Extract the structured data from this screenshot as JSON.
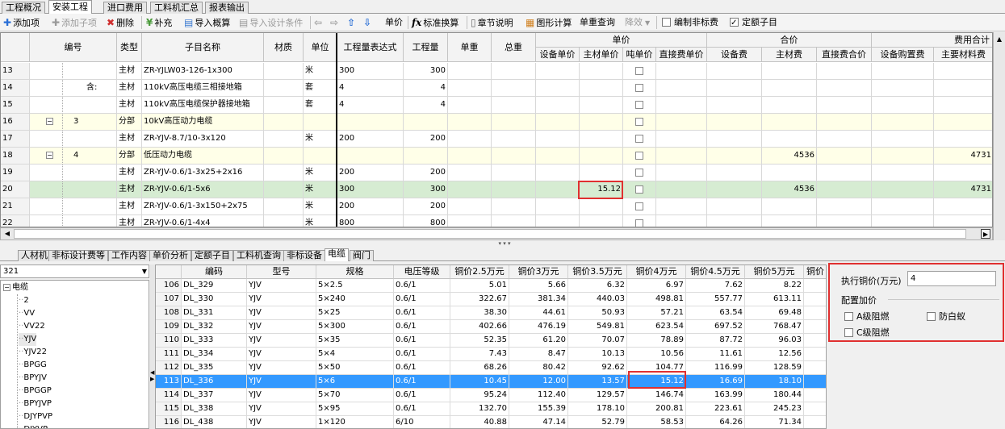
{
  "top_tabs": [
    "工程概况",
    "安装工程",
    "进口费用",
    "工料机汇总",
    "报表输出"
  ],
  "toolbar": {
    "add_item": "添加项",
    "add_subitem": "添加子项",
    "delete": "删除",
    "supplement": "补充",
    "import_estimate": "导入概算",
    "import_design": "导入设计条件",
    "unit_price": "单价",
    "standard_convert": "标准换算",
    "chapter_note": "章节说明",
    "graphic_calc": "图形计算",
    "unit_weight_query": "单重查询",
    "coefficient": "降效",
    "edit_nonstandard": "编制非标费",
    "quota_subitem": "定额子目"
  },
  "grid": {
    "headers": {
      "code": "编号",
      "type": "类型",
      "name": "子目名称",
      "material": "材质",
      "unit": "单位",
      "expr": "工程量表达式",
      "qty": "工程量",
      "unit_weight": "单重",
      "total_weight": "总重",
      "unit_price_group": "单价",
      "total_price_group": "合价",
      "fee_total_group": "费用合计",
      "equip_unit": "设备单价",
      "main_mat_unit": "主材单价",
      "ton_unit": "吨单价",
      "direct_fee_unit": "直接费单价",
      "equip_fee": "设备费",
      "main_mat_fee": "主材费",
      "direct_fee_total": "直接费合价",
      "equip_purchase": "设备购置费",
      "main_mat_cost": "主要材料费"
    },
    "rows": [
      {
        "num": "13",
        "code": "",
        "type": "主材",
        "name": "ZR-YJLW03-126-1x300",
        "unit": "米",
        "expr": "300",
        "qty": "300",
        "mat_unit": "",
        "main_mat_fee": "",
        "fee_total": ""
      },
      {
        "num": "14",
        "code": "含:",
        "type": "主材",
        "name": "110kV高压电缆三相接地箱",
        "unit": "套",
        "expr": "4",
        "qty": "4",
        "mat_unit": "",
        "main_mat_fee": "",
        "fee_total": ""
      },
      {
        "num": "15",
        "code": "",
        "type": "主材",
        "name": "110kV高压电缆保护器接地箱",
        "unit": "套",
        "expr": "4",
        "qty": "4",
        "mat_unit": "",
        "main_mat_fee": "",
        "fee_total": ""
      },
      {
        "num": "16",
        "code": "3",
        "type": "分部",
        "name": "10kV高压动力电缆",
        "unit": "",
        "expr": "",
        "qty": "",
        "mat_unit": "",
        "main_mat_fee": "",
        "fee_total": ""
      },
      {
        "num": "17",
        "code": "",
        "type": "主材",
        "name": "ZR-YJV-8.7/10-3x120",
        "unit": "米",
        "expr": "200",
        "qty": "200",
        "mat_unit": "",
        "main_mat_fee": "",
        "fee_total": ""
      },
      {
        "num": "18",
        "code": "4",
        "type": "分部",
        "name": "低压动力电缆",
        "unit": "",
        "expr": "",
        "qty": "",
        "mat_unit": "",
        "main_mat_fee": "4536",
        "fee_total": "4731"
      },
      {
        "num": "19",
        "code": "",
        "type": "主材",
        "name": "ZR-YJV-0.6/1-3x25+2x16",
        "unit": "米",
        "expr": "200",
        "qty": "200",
        "mat_unit": "",
        "main_mat_fee": "",
        "fee_total": ""
      },
      {
        "num": "20",
        "code": "",
        "type": "主材",
        "name": "ZR-YJV-0.6/1-5x6",
        "unit": "米",
        "expr": "300",
        "qty": "300",
        "mat_unit": "15.12",
        "main_mat_fee": "4536",
        "fee_total": "4731"
      },
      {
        "num": "21",
        "code": "",
        "type": "主材",
        "name": "ZR-YJV-0.6/1-3x150+2x75",
        "unit": "米",
        "expr": "200",
        "qty": "200",
        "mat_unit": "",
        "main_mat_fee": "",
        "fee_total": ""
      },
      {
        "num": "22",
        "code": "",
        "type": "主材",
        "name": "ZR-YJV-0.6/1-4x4",
        "unit": "米",
        "expr": "800",
        "qty": "800",
        "mat_unit": "",
        "main_mat_fee": "",
        "fee_total": ""
      }
    ]
  },
  "bottom_tabs": [
    "人材机",
    "非标设计费等",
    "工作内容",
    "单价分析",
    "定额子目",
    "工料机查询",
    "非标设备",
    "电缆",
    "阀门"
  ],
  "combo_value": "321",
  "tree": {
    "root": "电缆",
    "items": [
      "2",
      "VV",
      "VV22",
      "YJV",
      "YJV22",
      "BPGG",
      "BPYJV",
      "BPGGP",
      "BPYJVP",
      "DJYPVP",
      "DJYVP"
    ]
  },
  "price_grid": {
    "headers": [
      "编码",
      "型号",
      "规格",
      "电压等级",
      "铜价2.5万元",
      "铜价3万元",
      "铜价3.5万元",
      "铜价4万元",
      "铜价4.5万元",
      "铜价5万元",
      "铜价"
    ],
    "rows": [
      {
        "n": "106",
        "code": "DL_329",
        "model": "YJV",
        "spec": "5×2.5",
        "volt": "0.6/1",
        "p25": "5.01",
        "p30": "5.66",
        "p35": "6.32",
        "p40": "6.97",
        "p45": "7.62",
        "p50": "8.22"
      },
      {
        "n": "107",
        "code": "DL_330",
        "model": "YJV",
        "spec": "5×240",
        "volt": "0.6/1",
        "p25": "322.67",
        "p30": "381.34",
        "p35": "440.03",
        "p40": "498.81",
        "p45": "557.77",
        "p50": "613.11"
      },
      {
        "n": "108",
        "code": "DL_331",
        "model": "YJV",
        "spec": "5×25",
        "volt": "0.6/1",
        "p25": "38.30",
        "p30": "44.61",
        "p35": "50.93",
        "p40": "57.21",
        "p45": "63.54",
        "p50": "69.48"
      },
      {
        "n": "109",
        "code": "DL_332",
        "model": "YJV",
        "spec": "5×300",
        "volt": "0.6/1",
        "p25": "402.66",
        "p30": "476.19",
        "p35": "549.81",
        "p40": "623.54",
        "p45": "697.52",
        "p50": "768.47"
      },
      {
        "n": "110",
        "code": "DL_333",
        "model": "YJV",
        "spec": "5×35",
        "volt": "0.6/1",
        "p25": "52.35",
        "p30": "61.20",
        "p35": "70.07",
        "p40": "78.89",
        "p45": "87.72",
        "p50": "96.03"
      },
      {
        "n": "111",
        "code": "DL_334",
        "model": "YJV",
        "spec": "5×4",
        "volt": "0.6/1",
        "p25": "7.43",
        "p30": "8.47",
        "p35": "10.13",
        "p40": "10.56",
        "p45": "11.61",
        "p50": "12.56"
      },
      {
        "n": "112",
        "code": "DL_335",
        "model": "YJV",
        "spec": "5×50",
        "volt": "0.6/1",
        "p25": "68.26",
        "p30": "80.42",
        "p35": "92.62",
        "p40": "104.77",
        "p45": "116.99",
        "p50": "128.59"
      },
      {
        "n": "113",
        "code": "DL_336",
        "model": "YJV",
        "spec": "5×6",
        "volt": "0.6/1",
        "p25": "10.45",
        "p30": "12.00",
        "p35": "13.57",
        "p40": "15.12",
        "p45": "16.69",
        "p50": "18.10"
      },
      {
        "n": "114",
        "code": "DL_337",
        "model": "YJV",
        "spec": "5×70",
        "volt": "0.6/1",
        "p25": "95.24",
        "p30": "112.40",
        "p35": "129.57",
        "p40": "146.74",
        "p45": "163.99",
        "p50": "180.44"
      },
      {
        "n": "115",
        "code": "DL_338",
        "model": "YJV",
        "spec": "5×95",
        "volt": "0.6/1",
        "p25": "132.70",
        "p30": "155.39",
        "p35": "178.10",
        "p40": "200.81",
        "p45": "223.61",
        "p50": "245.23"
      },
      {
        "n": "116",
        "code": "DL_438",
        "model": "YJV",
        "spec": "1×120",
        "volt": "6/10",
        "p25": "40.88",
        "p30": "47.14",
        "p35": "52.79",
        "p40": "58.53",
        "p45": "64.26",
        "p50": "71.34"
      }
    ]
  },
  "panel": {
    "copper_label": "执行铜价(万元)",
    "copper_value": "4",
    "config_title": "配置加价",
    "opt_a": "A级阻燃",
    "opt_termite": "防白蚁",
    "opt_c": "C级阻燃"
  }
}
